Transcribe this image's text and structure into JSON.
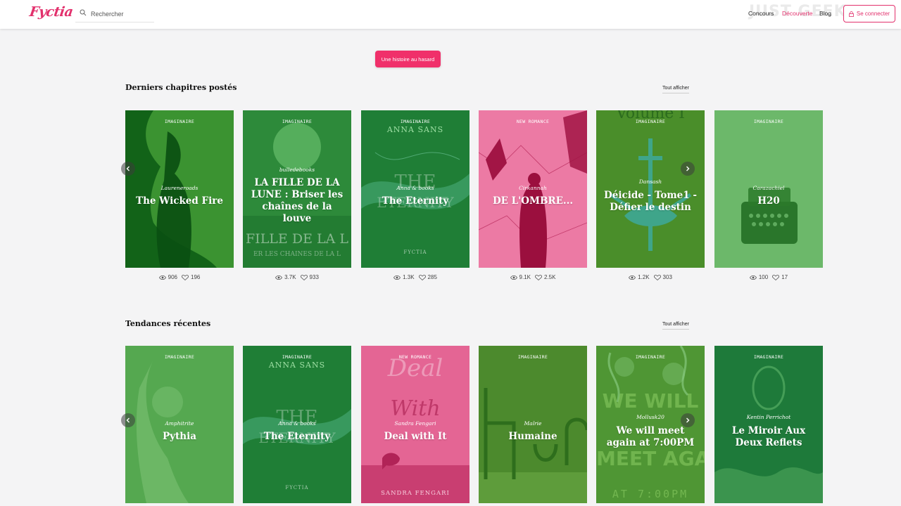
{
  "header": {
    "logo": "Fyctia",
    "search_placeholder": "Rechercher",
    "nav": {
      "concours": "Concours",
      "decouverte": "Découverte",
      "blog": "Blog"
    },
    "login_label": "Se connecter",
    "watermark": "JUST GEEK"
  },
  "random_story_label": "Une histoire au hasard",
  "sections": [
    {
      "title": "Derniers chapitres postés",
      "see_all": "Tout afficher",
      "cards": [
        {
          "genre": "IMAGINAIRE",
          "author": "Laureneroads",
          "title": "The Wicked Fire",
          "views": "906",
          "likes": "196"
        },
        {
          "genre": "IMAGINAIRE",
          "author": "bulledebooks",
          "title": "LA FILLE DE LA LUNE : Briser les chaînes de la louve",
          "views": "3.7K",
          "likes": "933",
          "cover_text": "FILLE DE LA L",
          "cover_sub": "ER LES CHAÎNES DE LA L"
        },
        {
          "genre": "IMAGINAIRE",
          "author": "Anna & books",
          "title": "The Eternity",
          "views": "1.3K",
          "likes": "285",
          "cover_top": "ANNA SANS",
          "cover_bottom": "FYCTIA"
        },
        {
          "genre": "NEW ROMANCE",
          "author": "Cirkannah",
          "title": "DE L'OMBRE...",
          "views": "9.1K",
          "likes": "2.5K"
        },
        {
          "genre": "IMAGINAIRE",
          "author": "Dansash",
          "title": "Déicide - Tome1 - Défier le destin",
          "views": "1.2K",
          "likes": "303",
          "cover_top": "Volume I"
        },
        {
          "genre": "IMAGINAIRE",
          "author": "Carazachiel",
          "title": "H20",
          "views": "100",
          "likes": "17"
        }
      ]
    },
    {
      "title": "Tendances récentes",
      "see_all": "Tout afficher",
      "cards": [
        {
          "genre": "IMAGINAIRE",
          "author": "Amphitrite",
          "title": "Pythia"
        },
        {
          "genre": "IMAGINAIRE",
          "author": "Anna & books",
          "title": "The Eternity",
          "cover_top": "ANNA SANS",
          "cover_bottom": "FYCTIA"
        },
        {
          "genre": "NEW ROMANCE",
          "author": "Sandra Fengari",
          "title": "Deal with It",
          "cover_top": "Deal",
          "cover_mid": "With",
          "cover_bottom": "SANDRA FENGARI"
        },
        {
          "genre": "IMAGINAIRE",
          "author": "Maîrie",
          "title": "Humaine"
        },
        {
          "genre": "IMAGINAIRE",
          "author": "Mollusk20",
          "title": "We will meet again at 7:00PM",
          "cover_top": "WE WILL",
          "cover_mid": "MEET AGAIN",
          "cover_bottom": "AT 7:00PM"
        },
        {
          "genre": "IMAGINAIRE",
          "author": "Kentin Perrichot",
          "title": "Le Miroir Aux Deux Reflets"
        }
      ]
    }
  ],
  "colors": {
    "brand": "#e2306c",
    "button": "#f0306a"
  }
}
